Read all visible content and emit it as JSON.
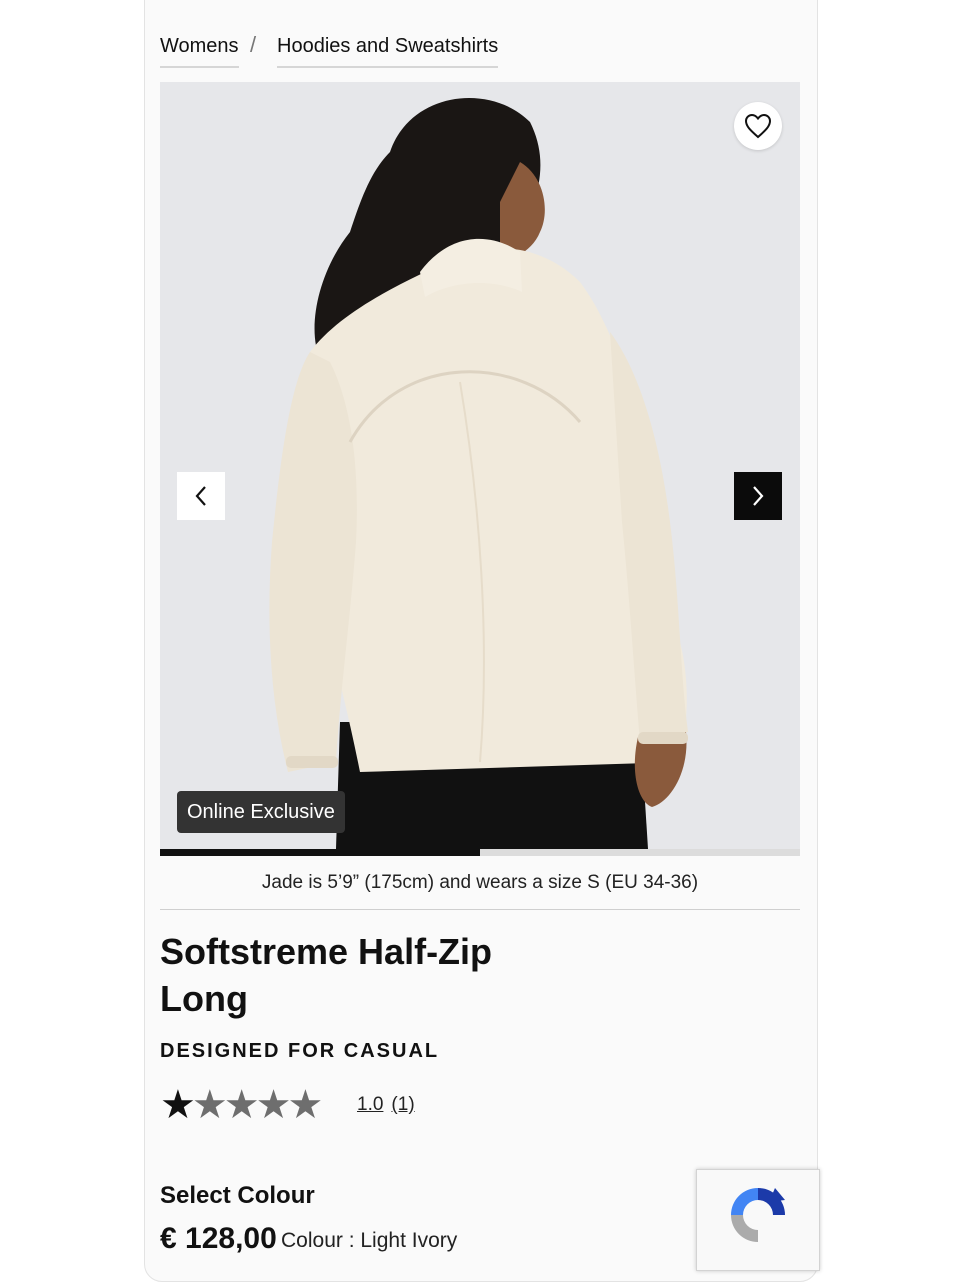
{
  "breadcrumb": {
    "items": [
      "Womens",
      "Hoodies and Sweatshirts"
    ],
    "separator": "/"
  },
  "gallery": {
    "badge": "Online Exclusive",
    "model_info": "Jade is 5’9” (175cm) and wears a size S (EU 34-36)",
    "progress_fraction": 0.5
  },
  "product": {
    "title": "Softstreme Half-Zip Long",
    "category": "DESIGNED FOR CASUAL",
    "rating_value": "1.0",
    "review_count": "(1)",
    "stars_filled": 1,
    "stars_total": 5,
    "select_colour_label": "Select Colour",
    "price": "€ 128,00",
    "colour_text": "Colour : Light Ivory"
  },
  "icons": {
    "favorite": "heart-icon",
    "prev": "chevron-left-icon",
    "next": "chevron-right-icon",
    "recaptcha": "recaptcha-icon"
  },
  "colors": {
    "accent": "#0b0b0b",
    "badge_bg": "#333333",
    "product_ivory": "#f1eadc"
  }
}
